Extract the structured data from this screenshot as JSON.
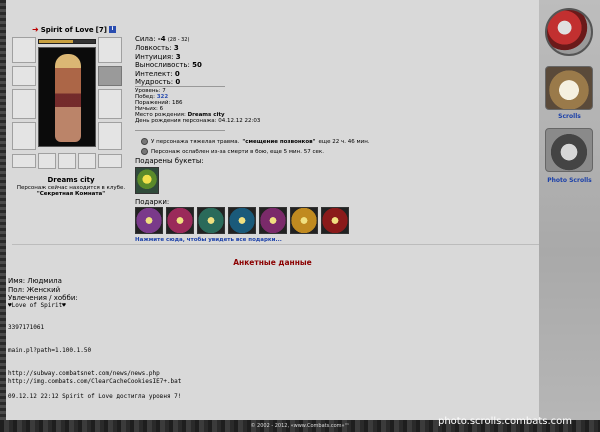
{
  "header": {
    "name": "Spirit of Love",
    "level": "[7]",
    "info_icon": "info-icon"
  },
  "stats": [
    {
      "label": "Сила:",
      "value": "-4",
      "extra": "(28 - 32)"
    },
    {
      "label": "Ловкость:",
      "value": "3"
    },
    {
      "label": "Интуиция:",
      "value": "3"
    },
    {
      "label": "Выносливость:",
      "value": "50"
    },
    {
      "label": "Интелект:",
      "value": "0"
    },
    {
      "label": "Мудрость:",
      "value": "0"
    }
  ],
  "facts": {
    "level": "Уровень: 7",
    "wins_label": "Побед:",
    "wins": "322",
    "losses": "Поражений: 186",
    "draws": "Ничьих: 6",
    "birthplace_label": "Место рождения:",
    "birthplace": "Dreams city",
    "birthday": "День рождения персонажа: 04.12.12 22:03"
  },
  "effects": {
    "e1_pre": "У персонажа тяжелая травма.",
    "e1_bold": "\"смещение позвонков\"",
    "e1_post": "еще 22 ч. 46 мин.",
    "e2": "Персонаж ослаблен из-за смерти в бою, еще 5 мин. 57 сек."
  },
  "location": {
    "city": "Dreams city",
    "status": "Персонаж сейчас находится в клубе.",
    "room": "\"Секретная Комната\""
  },
  "gifts": {
    "bouquets_label": "Подарены букеты:",
    "gifts_label": "Подарки:",
    "link": "Нажмите сюда, чтобы увидеть все подарки...",
    "items": [
      "#7a3a8a",
      "#9a2a5a",
      "#2a6a5a",
      "#1a5a7a",
      "#7a2a6a",
      "#c08a20",
      "#8a1a1a"
    ]
  },
  "anketa": {
    "title": "Анкетные данные",
    "name": "Имя: Людмила",
    "gender": "Пол: Женский",
    "hobby_label": "Увлечения / хобби:",
    "hobby": "♥Love of Spirit♥",
    "number": "3397171061",
    "path": "main.pl?path=1.100.1.50",
    "url1": "http://subway.combatsnet.com/news/news.php",
    "url2": "http://img.combats.com/ClearCacheCookiesIE7+.bat",
    "event": "09.12.12 22:12 Spirit of Love достигла уровня 7!"
  },
  "sidebar": {
    "scrolls": "Scrolls",
    "photo_scrolls": "Photo Scrolls"
  },
  "footer": {
    "copyright": "© 2002 - 2012, «www.Combats.com»™",
    "watermark": "photo.scrolls.combats.com"
  }
}
